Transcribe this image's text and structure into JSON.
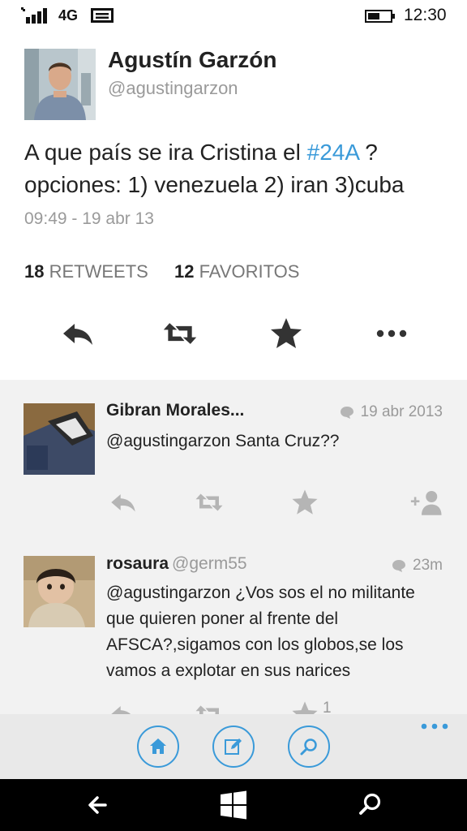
{
  "status_bar": {
    "network": "4G",
    "time": "12:30",
    "icons": [
      "signal-icon",
      "message-icon",
      "battery-icon"
    ]
  },
  "tweet": {
    "author_name": "Agustín Garzón",
    "author_handle": "@agustingarzon",
    "text_line1_before": "A que país se ira Cristina el ",
    "hashtag": "#24A",
    "text_line1_after": " ?",
    "text_line2": "opciones: 1) venezuela 2) iran 3)cuba",
    "timestamp": "09:49 - 19 abr 13",
    "retweets_count": "18",
    "retweets_label": "RETWEETS",
    "favorites_count": "12",
    "favorites_label": "FAVORITOS",
    "actions": [
      "reply-icon",
      "retweet-icon",
      "favorite-icon",
      "more-icon"
    ]
  },
  "replies": [
    {
      "name": "Gibran Morales...",
      "handle": "",
      "time": "19 abr 2013",
      "text": "@agustingarzon Santa Cruz??"
    },
    {
      "name": "rosaura",
      "handle": "@germ55",
      "time": "23m",
      "text": "@agustingarzon ¿Vos sos el no militante que quieren poner al frente del AFSCA?,sigamos con los globos,se los vamos a explotar en sus narices",
      "partial_count": "1"
    }
  ],
  "app_bar": {
    "buttons": [
      "home-icon",
      "compose-icon",
      "search-icon"
    ],
    "more": "more-icon"
  },
  "colors": {
    "accent": "#3a9ad9",
    "reply_background": "#f2f2f2",
    "app_bar": "#e9e9e9",
    "nav_bar": "#000000"
  }
}
